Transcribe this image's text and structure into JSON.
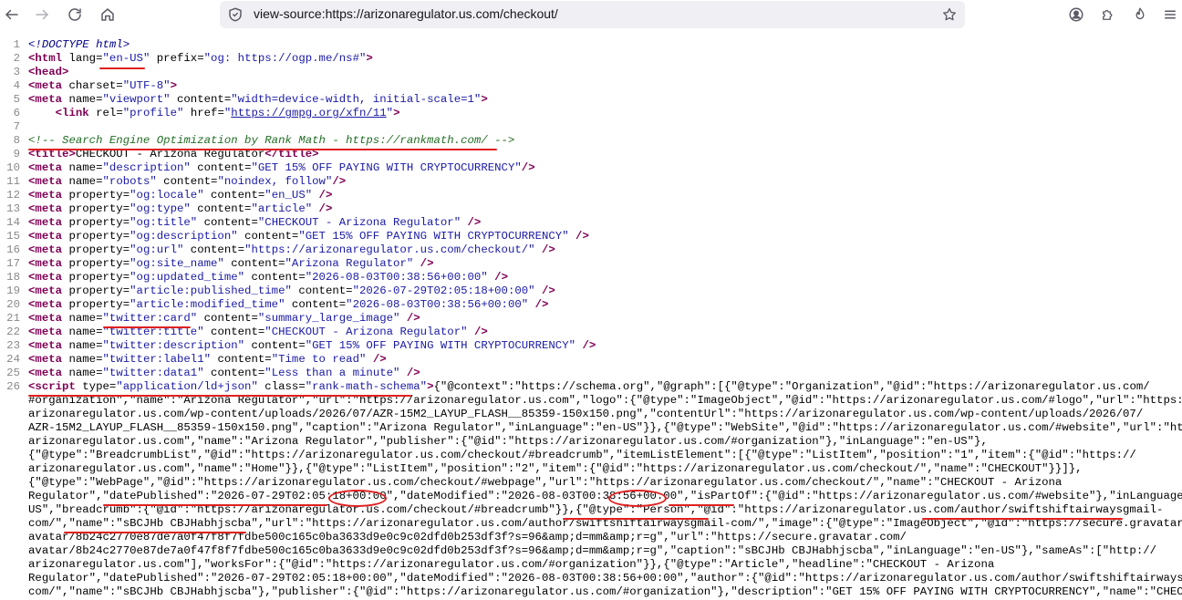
{
  "browser": {
    "url": "view-source:https://arizonaregulator.us.com/checkout/"
  },
  "source_lines": [
    {
      "n": "1",
      "parts": [
        [
          "dt",
          "<!DOCTYPE html>"
        ]
      ]
    },
    {
      "n": "2",
      "parts": [
        [
          "t",
          "<html"
        ],
        [
          "a",
          " lang="
        ],
        [
          "v",
          "\"en-US\""
        ],
        [
          "a",
          " prefix="
        ],
        [
          "v",
          "\"og: https://ogp.me/ns#\""
        ],
        [
          "t",
          ">"
        ]
      ]
    },
    {
      "n": "3",
      "parts": [
        [
          "t",
          "<head>"
        ]
      ]
    },
    {
      "n": "4",
      "parts": [
        [
          "t",
          "<meta"
        ],
        [
          "a",
          " charset="
        ],
        [
          "v",
          "\"UTF-8\""
        ],
        [
          "t",
          ">"
        ]
      ]
    },
    {
      "n": "5",
      "parts": [
        [
          "t",
          "<meta"
        ],
        [
          "a",
          " name="
        ],
        [
          "v",
          "\"viewport\""
        ],
        [
          "a",
          " content="
        ],
        [
          "v",
          "\"width=device-width, initial-scale=1\""
        ],
        [
          "t",
          ">"
        ]
      ]
    },
    {
      "n": "6",
      "parts": [
        [
          "txt",
          "    "
        ],
        [
          "t",
          "<link"
        ],
        [
          "a",
          " rel="
        ],
        [
          "v",
          "\"profile\""
        ],
        [
          "a",
          " href="
        ],
        [
          "v",
          "\""
        ],
        [
          "lnk",
          "https://gmpg.org/xfn/11"
        ],
        [
          "v",
          "\""
        ],
        [
          "t",
          ">"
        ]
      ]
    },
    {
      "n": "7",
      "parts": [
        [
          "txt",
          ""
        ]
      ]
    },
    {
      "n": "8",
      "parts": [
        [
          "c",
          "<!-- Search Engine Optimization by Rank Math - https://rankmath.com/ -->"
        ]
      ]
    },
    {
      "n": "9",
      "parts": [
        [
          "t",
          "<title>"
        ],
        [
          "txt",
          "CHECKOUT - Arizona Regulator"
        ],
        [
          "t",
          "</title>"
        ]
      ]
    },
    {
      "n": "10",
      "parts": [
        [
          "t",
          "<meta"
        ],
        [
          "a",
          " name="
        ],
        [
          "v",
          "\"description\""
        ],
        [
          "a",
          " content="
        ],
        [
          "v",
          "\"GET 15% OFF PAYING WITH CRYPTOCURRENCY\""
        ],
        [
          "t",
          "/>"
        ]
      ]
    },
    {
      "n": "11",
      "parts": [
        [
          "t",
          "<meta"
        ],
        [
          "a",
          " name="
        ],
        [
          "v",
          "\"robots\""
        ],
        [
          "a",
          " content="
        ],
        [
          "v",
          "\"noindex, follow\""
        ],
        [
          "t",
          "/>"
        ]
      ]
    },
    {
      "n": "12",
      "parts": [
        [
          "t",
          "<meta"
        ],
        [
          "a",
          " property="
        ],
        [
          "v",
          "\"og:locale\""
        ],
        [
          "a",
          " content="
        ],
        [
          "v",
          "\"en_US\""
        ],
        [
          "t",
          " />"
        ]
      ]
    },
    {
      "n": "13",
      "parts": [
        [
          "t",
          "<meta"
        ],
        [
          "a",
          " property="
        ],
        [
          "v",
          "\"og:type\""
        ],
        [
          "a",
          " content="
        ],
        [
          "v",
          "\"article\""
        ],
        [
          "t",
          " />"
        ]
      ]
    },
    {
      "n": "14",
      "parts": [
        [
          "t",
          "<meta"
        ],
        [
          "a",
          " property="
        ],
        [
          "v",
          "\"og:title\""
        ],
        [
          "a",
          " content="
        ],
        [
          "v",
          "\"CHECKOUT - Arizona Regulator\""
        ],
        [
          "t",
          " />"
        ]
      ]
    },
    {
      "n": "15",
      "parts": [
        [
          "t",
          "<meta"
        ],
        [
          "a",
          " property="
        ],
        [
          "v",
          "\"og:description\""
        ],
        [
          "a",
          " content="
        ],
        [
          "v",
          "\"GET 15% OFF PAYING WITH CRYPTOCURRENCY\""
        ],
        [
          "t",
          " />"
        ]
      ]
    },
    {
      "n": "16",
      "parts": [
        [
          "t",
          "<meta"
        ],
        [
          "a",
          " property="
        ],
        [
          "v",
          "\"og:url\""
        ],
        [
          "a",
          " content="
        ],
        [
          "v",
          "\"https://arizonaregulator.us.com/checkout/\""
        ],
        [
          "t",
          " />"
        ]
      ]
    },
    {
      "n": "17",
      "parts": [
        [
          "t",
          "<meta"
        ],
        [
          "a",
          " property="
        ],
        [
          "v",
          "\"og:site_name\""
        ],
        [
          "a",
          " content="
        ],
        [
          "v",
          "\"Arizona Regulator\""
        ],
        [
          "t",
          " />"
        ]
      ]
    },
    {
      "n": "18",
      "parts": [
        [
          "t",
          "<meta"
        ],
        [
          "a",
          " property="
        ],
        [
          "v",
          "\"og:updated_time\""
        ],
        [
          "a",
          " content="
        ],
        [
          "v",
          "\"2026-08-03T00:38:56+00:00\""
        ],
        [
          "t",
          " />"
        ]
      ]
    },
    {
      "n": "19",
      "parts": [
        [
          "t",
          "<meta"
        ],
        [
          "a",
          " property="
        ],
        [
          "v",
          "\"article:published_time\""
        ],
        [
          "a",
          " content="
        ],
        [
          "v",
          "\"2026-07-29T02:05:18+00:00\""
        ],
        [
          "t",
          " />"
        ]
      ]
    },
    {
      "n": "20",
      "parts": [
        [
          "t",
          "<meta"
        ],
        [
          "a",
          " property="
        ],
        [
          "v",
          "\"article:modified_time\""
        ],
        [
          "a",
          " content="
        ],
        [
          "v",
          "\"2026-08-03T00:38:56+00:00\""
        ],
        [
          "t",
          " />"
        ]
      ]
    },
    {
      "n": "21",
      "parts": [
        [
          "t",
          "<meta"
        ],
        [
          "a",
          " name="
        ],
        [
          "v",
          "\"twitter:card\""
        ],
        [
          "a",
          " content="
        ],
        [
          "v",
          "\"summary_large_image\""
        ],
        [
          "t",
          " />"
        ]
      ]
    },
    {
      "n": "22",
      "parts": [
        [
          "t",
          "<meta"
        ],
        [
          "a",
          " name="
        ],
        [
          "v",
          "\"twitter:title\""
        ],
        [
          "a",
          " content="
        ],
        [
          "v",
          "\"CHECKOUT - Arizona Regulator\""
        ],
        [
          "t",
          " />"
        ]
      ]
    },
    {
      "n": "23",
      "parts": [
        [
          "t",
          "<meta"
        ],
        [
          "a",
          " name="
        ],
        [
          "v",
          "\"twitter:description\""
        ],
        [
          "a",
          " content="
        ],
        [
          "v",
          "\"GET 15% OFF PAYING WITH CRYPTOCURRENCY\""
        ],
        [
          "t",
          " />"
        ]
      ]
    },
    {
      "n": "24",
      "parts": [
        [
          "t",
          "<meta"
        ],
        [
          "a",
          " name="
        ],
        [
          "v",
          "\"twitter:label1\""
        ],
        [
          "a",
          " content="
        ],
        [
          "v",
          "\"Time to read\""
        ],
        [
          "t",
          " />"
        ]
      ]
    },
    {
      "n": "25",
      "parts": [
        [
          "t",
          "<meta"
        ],
        [
          "a",
          " name="
        ],
        [
          "v",
          "\"twitter:data1\""
        ],
        [
          "a",
          " content="
        ],
        [
          "v",
          "\"Less than a minute\""
        ],
        [
          "t",
          " />"
        ]
      ]
    },
    {
      "n": "26",
      "parts": [
        [
          "t",
          "<script"
        ],
        [
          "a",
          " type="
        ],
        [
          "v",
          "\"application/ld+json\""
        ],
        [
          "a",
          " class="
        ],
        [
          "v",
          "\"rank-math-schema\""
        ],
        [
          "t",
          ">"
        ],
        [
          "txt",
          "{\"@context\":\"https://schema.org\",\"@graph\":[{\"@type\":\"Organization\",\"@id\":\"https://arizonaregulator.us.com/"
        ]
      ]
    },
    {
      "n": "",
      "parts": [
        [
          "txt",
          "#organization\",\"name\":\"Arizona Regulator\",\"url\":\"https://arizonaregulator.us.com\",\"logo\":{\"@type\":\"ImageObject\",\"@id\":\"https://arizonaregulator.us.com/#logo\",\"url\":\"https://"
        ]
      ]
    },
    {
      "n": "",
      "parts": [
        [
          "txt",
          "arizonaregulator.us.com/wp-content/uploads/2026/07/AZR-15M2_LAYUP_FLASH__85359-150x150.png\",\"contentUrl\":\"https://arizonaregulator.us.com/wp-content/uploads/2026/07/"
        ]
      ]
    },
    {
      "n": "",
      "parts": [
        [
          "txt",
          "AZR-15M2_LAYUP_FLASH__85359-150x150.png\",\"caption\":\"Arizona Regulator\",\"inLanguage\":\"en-US\"}},{\"@type\":\"WebSite\",\"@id\":\"https://arizonaregulator.us.com/#website\",\"url\":\"https://"
        ]
      ]
    },
    {
      "n": "",
      "parts": [
        [
          "txt",
          "arizonaregulator.us.com\",\"name\":\"Arizona Regulator\",\"publisher\":{\"@id\":\"https://arizonaregulator.us.com/#organization\"},\"inLanguage\":\"en-US\"},"
        ]
      ]
    },
    {
      "n": "",
      "parts": [
        [
          "txt",
          "{\"@type\":\"BreadcrumbList\",\"@id\":\"https://arizonaregulator.us.com/checkout/#breadcrumb\",\"itemListElement\":[{\"@type\":\"ListItem\",\"position\":\"1\",\"item\":{\"@id\":\"https://"
        ]
      ]
    },
    {
      "n": "",
      "parts": [
        [
          "txt",
          "arizonaregulator.us.com\",\"name\":\"Home\"}},{\"@type\":\"ListItem\",\"position\":\"2\",\"item\":{\"@id\":\"https://arizonaregulator.us.com/checkout/\",\"name\":\"CHECKOUT\"}}]},"
        ]
      ]
    },
    {
      "n": "",
      "parts": [
        [
          "txt",
          "{\"@type\":\"WebPage\",\"@id\":\"https://arizonaregulator.us.com/checkout/#webpage\",\"url\":\"https://arizonaregulator.us.com/checkout/\",\"name\":\"CHECKOUT - Arizona"
        ]
      ]
    },
    {
      "n": "",
      "parts": [
        [
          "txt",
          "Regulator\",\"datePublished\":\"2026-07-29T02:05:18+00:00\",\"dateModified\":\"2026-08-03T00:38:56+00:00\",\"isPartOf\":{\"@id\":\"https://arizonaregulator.us.com/#website\"},\"inLanguage\":\"en-"
        ]
      ]
    },
    {
      "n": "",
      "parts": [
        [
          "txt",
          "US\",\"breadcrumb\":{\"@id\":\"https://arizonaregulator.us.com/checkout/#breadcrumb\"}},{\"@type\":\"Person\",\"@id\":\"https://arizonaregulator.us.com/author/swiftshiftairwaysgmail-"
        ]
      ]
    },
    {
      "n": "",
      "parts": [
        [
          "txt",
          "com/\",\"name\":\"sBCJHb CBJHabhjscba\",\"url\":\"https://arizonaregulator.us.com/author/swiftshiftairwaysgmail-com/\",\"image\":{\"@type\":\"ImageObject\",\"@id\":\"https://secure.gravatar.com/"
        ]
      ]
    },
    {
      "n": "",
      "parts": [
        [
          "txt",
          "avatar/8b24c2770e87de7a0f47f8f7fdbe500c165c0ba3633d9e0c9c02dfd0b253df3f?s=96&amp;d=mm&amp;r=g\",\"url\":\"https://secure.gravatar.com/"
        ]
      ]
    },
    {
      "n": "",
      "parts": [
        [
          "txt",
          "avatar/8b24c2770e87de7a0f47f8f7fdbe500c165c0ba3633d9e0c9c02dfd0b253df3f?s=96&amp;d=mm&amp;r=g\",\"caption\":\"sBCJHb CBJHabhjscba\",\"inLanguage\":\"en-US\"},\"sameAs\":[\"http://"
        ]
      ]
    },
    {
      "n": "",
      "parts": [
        [
          "txt",
          "arizonaregulator.us.com\"],\"worksFor\":{\"@id\":\"https://arizonaregulator.us.com/#organization\"}},{\"@type\":\"Article\",\"headline\":\"CHECKOUT - Arizona"
        ]
      ]
    },
    {
      "n": "",
      "parts": [
        [
          "txt",
          "Regulator\",\"datePublished\":\"2026-07-29T02:05:18+00:00\",\"dateModified\":\"2026-08-03T00:38:56+00:00\",\"author\":{\"@id\":\"https://arizonaregulator.us.com/author/swiftshiftairwaysgmail-"
        ]
      ]
    },
    {
      "n": "",
      "parts": [
        [
          "txt",
          "com/\",\"name\":\"sBCJHb CBJHabhjscba\"},\"publisher\":{\"@id\":\"https://arizonaregulator.us.com/#organization\"},\"description\":\"GET 15% OFF PAYING WITH CRYPTOCURRENCY\",\"name\":\"CHECKOUT - "
        ]
      ]
    }
  ]
}
